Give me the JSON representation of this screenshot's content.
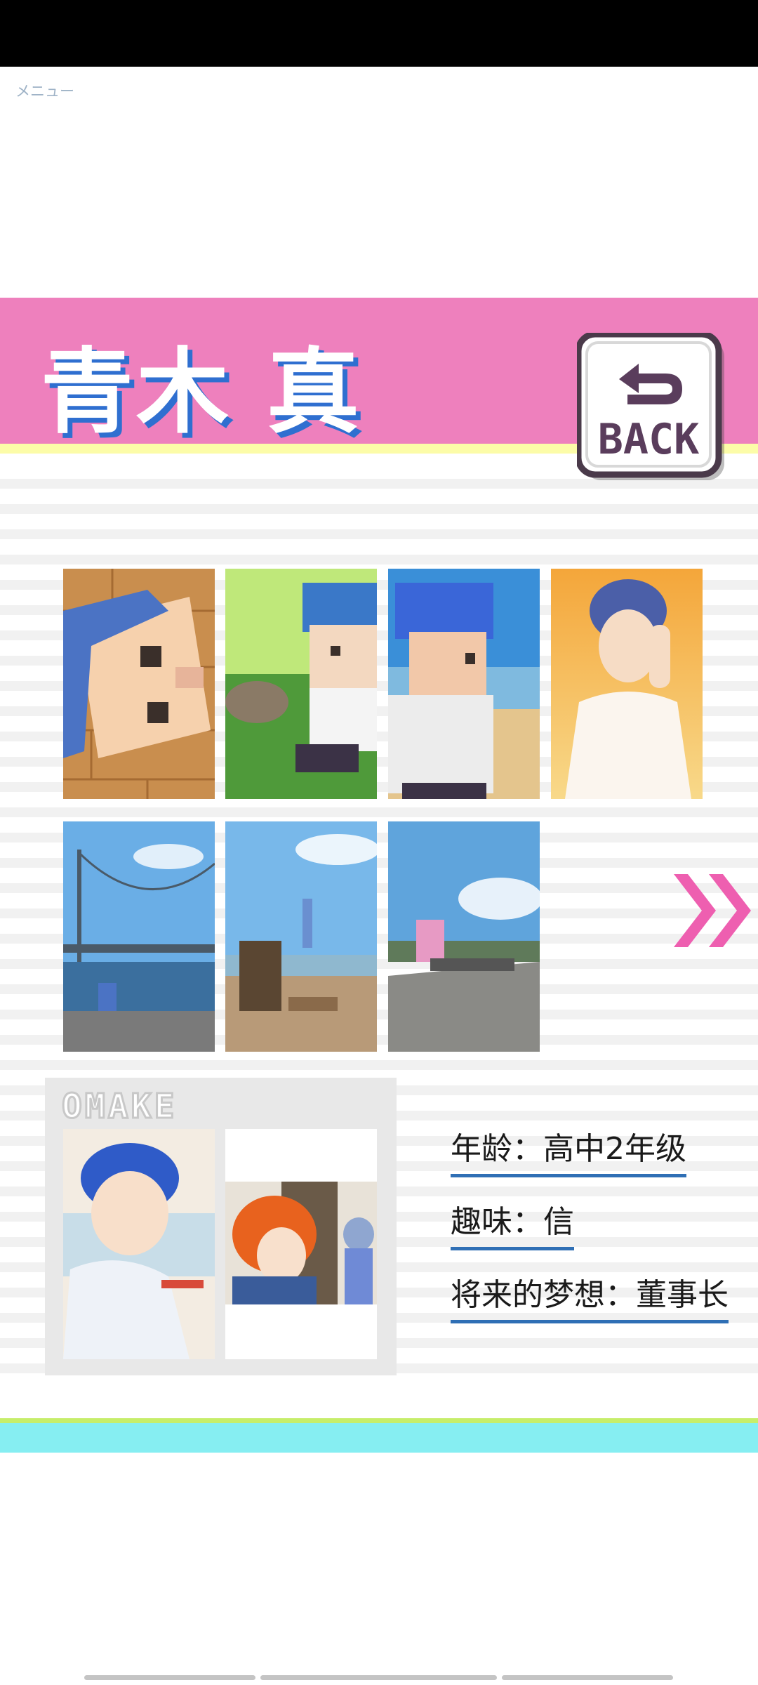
{
  "menu_label": "メニュー",
  "profile": {
    "name": "青木 真",
    "back_label": "BACK",
    "info": {
      "age": "年龄：高中2年级",
      "hobby": "趣味：信",
      "dream": "将来的梦想：董事长"
    }
  },
  "gallery": {
    "row1": [
      "pixel-face-closeup",
      "pixel-boy-with-cat",
      "pixel-boy-at-beach",
      "anime-boy-sunset"
    ],
    "row2": [
      "bridge-photo",
      "lookout-photo",
      "boardwalk-photo"
    ],
    "next_icon": "double-chevron-right-icon"
  },
  "omake": {
    "label": "OMAKE",
    "images": [
      "boy-eating-sushi",
      "siblings-illustration"
    ]
  },
  "colors": {
    "banner": "#ee80bd",
    "banner_stripe": "#fcfca8",
    "title_shadow": "#2f6fd0",
    "info_underline": "#2f6fb5",
    "footer_green": "#c6ee6a",
    "footer_cyan": "#86eef2",
    "arrow_pink": "#ee5fb0"
  }
}
